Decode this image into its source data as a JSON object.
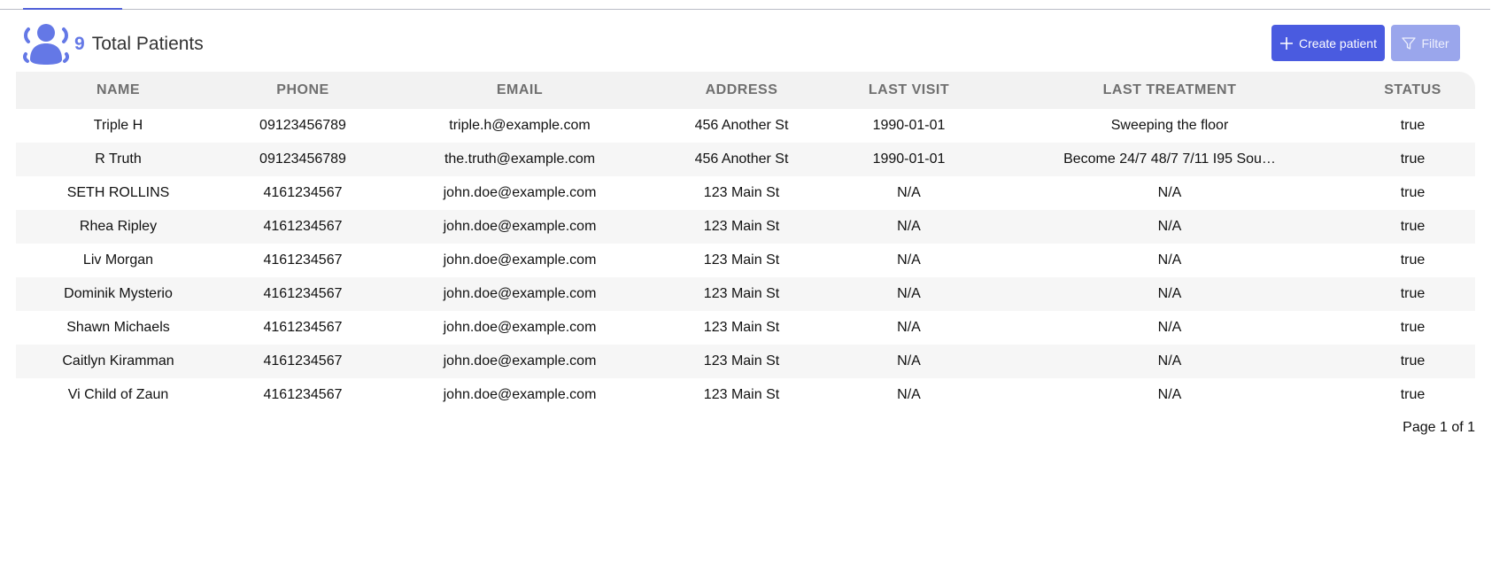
{
  "header": {
    "count": "9",
    "title": "Total Patients",
    "icon": "patients-group-icon",
    "accent_color": "#6478e6"
  },
  "toolbar": {
    "create_label": "Create patient",
    "filter_label": "Filter",
    "create_color": "#4a5be0",
    "filter_color": "#9aa6ec"
  },
  "table": {
    "columns": [
      "NAME",
      "PHONE",
      "EMAIL",
      "ADDRESS",
      "LAST VISIT",
      "LAST TREATMENT",
      "STATUS"
    ],
    "rows": [
      [
        "Triple H",
        "09123456789",
        "triple.h@example.com",
        "456 Another St",
        "1990-01-01",
        "Sweeping the floor",
        "true"
      ],
      [
        "R Truth",
        "09123456789",
        "the.truth@example.com",
        "456 Another St",
        "1990-01-01",
        "Become 24/7 48/7 7/11 I95 Sou…",
        "true"
      ],
      [
        "SETH ROLLINS",
        "4161234567",
        "john.doe@example.com",
        "123 Main St",
        "N/A",
        "N/A",
        "true"
      ],
      [
        "Rhea Ripley",
        "4161234567",
        "john.doe@example.com",
        "123 Main St",
        "N/A",
        "N/A",
        "true"
      ],
      [
        "Liv Morgan",
        "4161234567",
        "john.doe@example.com",
        "123 Main St",
        "N/A",
        "N/A",
        "true"
      ],
      [
        "Dominik Mysterio",
        "4161234567",
        "john.doe@example.com",
        "123 Main St",
        "N/A",
        "N/A",
        "true"
      ],
      [
        "Shawn Michaels",
        "4161234567",
        "john.doe@example.com",
        "123 Main St",
        "N/A",
        "N/A",
        "true"
      ],
      [
        "Caitlyn Kiramman",
        "4161234567",
        "john.doe@example.com",
        "123 Main St",
        "N/A",
        "N/A",
        "true"
      ],
      [
        "Vi Child of Zaun",
        "4161234567",
        "john.doe@example.com",
        "123 Main St",
        "N/A",
        "N/A",
        "true"
      ]
    ]
  },
  "pagination": {
    "label": "Page 1 of 1"
  }
}
